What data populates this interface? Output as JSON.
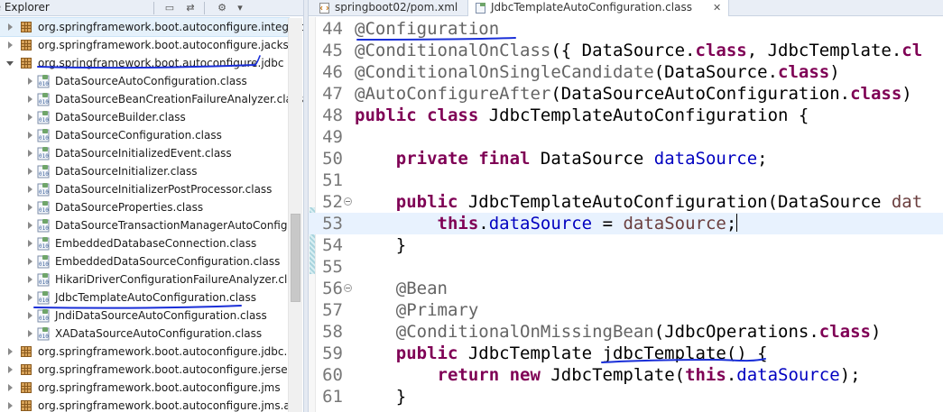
{
  "explorer": {
    "title": "ge Explorer",
    "rows": [
      {
        "kind": "package",
        "label": "org.springframework.boot.autoconfigure.integration",
        "expanded": false,
        "hover": true
      },
      {
        "kind": "package",
        "label": "org.springframework.boot.autoconfigure.jackso",
        "expanded": false
      },
      {
        "kind": "package",
        "label": "org.springframework.boot.autoconfigure.jdbc",
        "expanded": true,
        "underlined": true
      },
      {
        "kind": "class",
        "label": "DataSourceAutoConfiguration.class"
      },
      {
        "kind": "class",
        "label": "DataSourceBeanCreationFailureAnalyzer.class"
      },
      {
        "kind": "class",
        "label": "DataSourceBuilder.class"
      },
      {
        "kind": "class",
        "label": "DataSourceConfiguration.class"
      },
      {
        "kind": "class",
        "label": "DataSourceInitializedEvent.class"
      },
      {
        "kind": "class",
        "label": "DataSourceInitializer.class"
      },
      {
        "kind": "class",
        "label": "DataSourceInitializerPostProcessor.class"
      },
      {
        "kind": "class",
        "label": "DataSourceProperties.class"
      },
      {
        "kind": "class",
        "label": "DataSourceTransactionManagerAutoConfigu"
      },
      {
        "kind": "class",
        "label": "EmbeddedDatabaseConnection.class"
      },
      {
        "kind": "class",
        "label": "EmbeddedDataSourceConfiguration.class"
      },
      {
        "kind": "class",
        "label": "HikariDriverConfigurationFailureAnalyzer.clas"
      },
      {
        "kind": "class",
        "label": "JdbcTemplateAutoConfiguration.class",
        "selected": true,
        "underlined": true
      },
      {
        "kind": "class",
        "label": "JndiDataSourceAutoConfiguration.class"
      },
      {
        "kind": "class",
        "label": "XADataSourceAutoConfiguration.class"
      },
      {
        "kind": "package",
        "label": "org.springframework.boot.autoconfigure.jdbc.m",
        "expanded": false
      },
      {
        "kind": "package",
        "label": "org.springframework.boot.autoconfigure.jersey",
        "expanded": false
      },
      {
        "kind": "package",
        "label": "org.springframework.boot.autoconfigure.jms",
        "expanded": false
      },
      {
        "kind": "package",
        "label": "org.springframework.boot.autoconfigure.jms.ac",
        "expanded": false
      }
    ]
  },
  "editor": {
    "tabs": [
      {
        "label": "springboot02/pom.xml",
        "icon": "xml-file-icon",
        "active": false
      },
      {
        "label": "JdbcTemplateAutoConfiguration.class",
        "icon": "class-file-icon",
        "active": true,
        "close": "✕"
      }
    ],
    "lines": [
      {
        "num": "44",
        "tokens": [
          {
            "t": "ann",
            "v": "@Configuration"
          }
        ]
      },
      {
        "num": "45",
        "tokens": [
          {
            "t": "ann",
            "v": "@ConditionalOnClass"
          },
          {
            "t": "plain",
            "v": "({ DataSource."
          },
          {
            "t": "kw",
            "v": "class"
          },
          {
            "t": "plain",
            "v": ", JdbcTemplate."
          },
          {
            "t": "kw",
            "v": "cl"
          }
        ]
      },
      {
        "num": "46",
        "tokens": [
          {
            "t": "ann",
            "v": "@ConditionalOnSingleCandidate"
          },
          {
            "t": "plain",
            "v": "(DataSource."
          },
          {
            "t": "kw",
            "v": "class"
          },
          {
            "t": "plain",
            "v": ")"
          }
        ]
      },
      {
        "num": "47",
        "tokens": [
          {
            "t": "ann",
            "v": "@AutoConfigureAfter"
          },
          {
            "t": "plain",
            "v": "(DataSourceAutoConfiguration."
          },
          {
            "t": "kw",
            "v": "class"
          },
          {
            "t": "plain",
            "v": ")"
          }
        ]
      },
      {
        "num": "48",
        "tokens": [
          {
            "t": "kw",
            "v": "public class "
          },
          {
            "t": "plain",
            "v": "JdbcTemplateAutoConfiguration {"
          }
        ]
      },
      {
        "num": "49",
        "tokens": []
      },
      {
        "num": "50",
        "tokens": [
          {
            "t": "plain",
            "v": "    "
          },
          {
            "t": "kw",
            "v": "private final "
          },
          {
            "t": "plain",
            "v": "DataSource "
          },
          {
            "t": "field",
            "v": "dataSource"
          },
          {
            "t": "plain",
            "v": ";"
          }
        ]
      },
      {
        "num": "51",
        "tokens": []
      },
      {
        "num": "52",
        "fold": true,
        "tokens": [
          {
            "t": "plain",
            "v": "    "
          },
          {
            "t": "kw",
            "v": "public "
          },
          {
            "t": "plain",
            "v": "JdbcTemplateAutoConfiguration(DataSource "
          },
          {
            "t": "param",
            "v": "dat"
          }
        ]
      },
      {
        "num": "53",
        "current": true,
        "caret": true,
        "tokens": [
          {
            "t": "plain",
            "v": "        "
          },
          {
            "t": "kw",
            "v": "this"
          },
          {
            "t": "plain",
            "v": "."
          },
          {
            "t": "field",
            "v": "dataSource"
          },
          {
            "t": "plain",
            "v": " = "
          },
          {
            "t": "param",
            "v": "dataSource"
          },
          {
            "t": "plain",
            "v": ";"
          }
        ]
      },
      {
        "num": "54",
        "tokens": [
          {
            "t": "plain",
            "v": "    }"
          }
        ]
      },
      {
        "num": "55",
        "tokens": []
      },
      {
        "num": "56",
        "fold": true,
        "tokens": [
          {
            "t": "plain",
            "v": "    "
          },
          {
            "t": "ann",
            "v": "@Bean"
          }
        ]
      },
      {
        "num": "57",
        "tokens": [
          {
            "t": "plain",
            "v": "    "
          },
          {
            "t": "ann",
            "v": "@Primary"
          }
        ]
      },
      {
        "num": "58",
        "tokens": [
          {
            "t": "plain",
            "v": "    "
          },
          {
            "t": "ann",
            "v": "@ConditionalOnMissingBean"
          },
          {
            "t": "plain",
            "v": "(JdbcOperations."
          },
          {
            "t": "kw",
            "v": "class"
          },
          {
            "t": "plain",
            "v": ")"
          }
        ]
      },
      {
        "num": "59",
        "tokens": [
          {
            "t": "plain",
            "v": "    "
          },
          {
            "t": "kw",
            "v": "public "
          },
          {
            "t": "plain",
            "v": "JdbcTemplate jdbcTemplate() {"
          }
        ]
      },
      {
        "num": "60",
        "tokens": [
          {
            "t": "plain",
            "v": "        "
          },
          {
            "t": "kw",
            "v": "return new "
          },
          {
            "t": "plain",
            "v": "JdbcTemplate("
          },
          {
            "t": "kw",
            "v": "this"
          },
          {
            "t": "plain",
            "v": "."
          },
          {
            "t": "field",
            "v": "dataSource"
          },
          {
            "t": "plain",
            "v": ");"
          }
        ]
      },
      {
        "num": "61",
        "tokens": [
          {
            "t": "plain",
            "v": "    }"
          }
        ]
      }
    ]
  },
  "colors": {
    "annotation": "#646464",
    "keyword": "#7f0055",
    "field": "#0000c0",
    "parameter": "#6a3e3e",
    "ink": "#1a2fd8"
  }
}
